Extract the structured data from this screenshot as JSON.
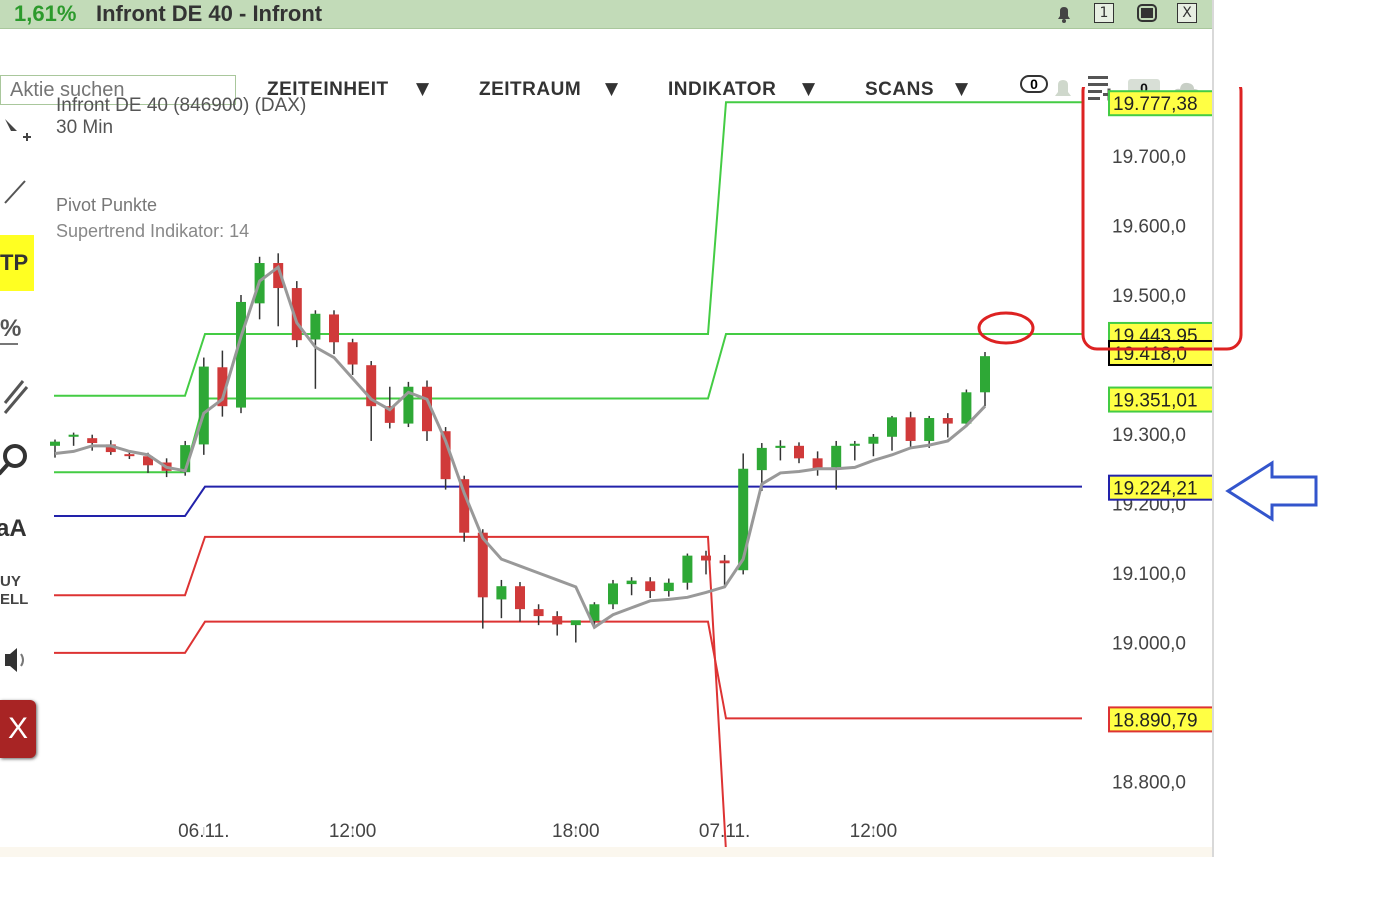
{
  "titlebar": {
    "change_pct": "1,61%",
    "name": "Infront DE 40 - Infront",
    "buttons": [
      "1",
      "X"
    ]
  },
  "toolbar": {
    "search_placeholder": "Aktie suchen",
    "menus": [
      "ZEITEINHEIT",
      "ZEITRAUM",
      "INDIKATOR",
      "SCANS"
    ],
    "caret": "▼",
    "alerts_count": "0",
    "list_count": "0"
  },
  "chart": {
    "instrument": "Infront DE 40 (846900) (DAX)",
    "interval": "30 Min",
    "indicator_1": "Pivot Punkte",
    "indicator_2": "Supertrend Indikator: 14"
  },
  "left_tools": {
    "tp": "TP",
    "percent": "%",
    "text_tool": "aA",
    "buy": "UY",
    "sell": "ELL",
    "close": "X"
  },
  "colors": {
    "up_candle": "#2ea836",
    "down_candle": "#d03a3a",
    "resistance": "#44cc44",
    "pivot": "#2222aa",
    "support": "#dd3333",
    "supertrend": "#999999",
    "price_label_bg": "#ffff44",
    "annotation_red": "#dd2222",
    "annotation_blue": "#3355cc"
  },
  "chart_data": {
    "type": "candlestick",
    "y_ticks": [
      "19.700,0",
      "19.600,0",
      "19.500,0",
      "19.300,0",
      "19.200,0",
      "19.100,0",
      "19.000,0",
      "18.800,0"
    ],
    "x_ticks": [
      "06.11.",
      "12:00",
      "18:00",
      "07.11.",
      "12:00"
    ],
    "price_labels": [
      {
        "text": "19.777,38",
        "color": "#44cc44"
      },
      {
        "text": "19.443,95",
        "color": "#44cc44"
      },
      {
        "text": "19.418,0",
        "color": "#000000"
      },
      {
        "text": "19.351,01",
        "color": "#44cc44"
      },
      {
        "text": "19.224,21",
        "color": "#2222aa"
      },
      {
        "text": "18.890,79",
        "color": "#dd3333"
      }
    ],
    "pivot_levels": {
      "R2": [
        19355,
        19777.38
      ],
      "R1": [
        19245,
        19443.95
      ],
      "PP": [
        19182,
        19224.21
      ],
      "S1": [
        19068,
        19057
      ],
      "S2": [
        18985,
        19030,
        18890.79
      ]
    },
    "candles": [
      [
        19283,
        19292,
        19275,
        19266,
        19289
      ],
      [
        19296,
        19302,
        19280,
        19283,
        19299
      ],
      [
        19294,
        19299,
        19274,
        19276,
        19287
      ],
      [
        19285,
        19291,
        19265,
        19270,
        19274
      ],
      [
        19271,
        19275,
        19261,
        19264,
        19269
      ],
      [
        19268,
        19273,
        19246,
        19244,
        19255
      ],
      [
        19259,
        19265,
        19240,
        19238,
        19247
      ],
      [
        19245,
        19290,
        19242,
        19240,
        19284
      ],
      [
        19285,
        19410,
        19275,
        19270,
        19397
      ],
      [
        19396,
        19420,
        19330,
        19325,
        19340
      ],
      [
        19338,
        19500,
        19333,
        19330,
        19490
      ],
      [
        19488,
        19555,
        19470,
        19465,
        19546
      ],
      [
        19546,
        19560,
        19470,
        19455,
        19510
      ],
      [
        19510,
        19520,
        19430,
        19425,
        19435
      ],
      [
        19436,
        19478,
        19425,
        19365,
        19473
      ],
      [
        19472,
        19478,
        19422,
        19415,
        19432
      ],
      [
        19432,
        19437,
        19390,
        19385,
        19400
      ],
      [
        19399,
        19405,
        19330,
        19290,
        19340
      ],
      [
        19340,
        19368,
        19310,
        19308,
        19316
      ],
      [
        19315,
        19375,
        19312,
        19310,
        19368
      ],
      [
        19368,
        19377,
        19296,
        19290,
        19304
      ],
      [
        19304,
        19310,
        19232,
        19220,
        19235
      ],
      [
        19235,
        19240,
        19150,
        19145,
        19158
      ],
      [
        19158,
        19163,
        19055,
        19020,
        19065
      ],
      [
        19062,
        19090,
        19038,
        19035,
        19081
      ],
      [
        19081,
        19087,
        19042,
        19030,
        19048
      ],
      [
        19048,
        19055,
        19030,
        19025,
        19038
      ],
      [
        19038,
        19045,
        19020,
        19010,
        19026
      ],
      [
        19025,
        19030,
        19020,
        19000,
        19032
      ],
      [
        19031,
        19058,
        19024,
        19020,
        19055
      ],
      [
        19055,
        19090,
        19052,
        19048,
        19085
      ],
      [
        19084,
        19094,
        19074,
        19068,
        19089
      ],
      [
        19088,
        19094,
        19068,
        19064,
        19074
      ],
      [
        19074,
        19092,
        19068,
        19066,
        19086
      ],
      [
        19086,
        19128,
        19080,
        19076,
        19125
      ],
      [
        19125,
        19132,
        19112,
        19098,
        19118
      ],
      [
        19118,
        19126,
        19090,
        19082,
        19114
      ],
      [
        19104,
        19272,
        19100,
        19098,
        19250
      ],
      [
        19248,
        19287,
        19240,
        19218,
        19280
      ],
      [
        19280,
        19291,
        19268,
        19262,
        19283
      ],
      [
        19283,
        19288,
        19262,
        19258,
        19265
      ],
      [
        19265,
        19275,
        19244,
        19240,
        19250
      ],
      [
        19252,
        19290,
        19248,
        19220,
        19283
      ],
      [
        19283,
        19290,
        19270,
        19262,
        19286
      ],
      [
        19286,
        19300,
        19272,
        19268,
        19296
      ],
      [
        19296,
        19326,
        19280,
        19276,
        19324
      ],
      [
        19324,
        19332,
        19284,
        19280,
        19290
      ],
      [
        19290,
        19326,
        19282,
        19280,
        19323
      ],
      [
        19323,
        19330,
        19310,
        19295,
        19315
      ],
      [
        19315,
        19364,
        19312,
        19310,
        19360
      ],
      [
        19360,
        19418,
        19355,
        19340,
        19412
      ]
    ],
    "supertrend": [
      19272,
      19275,
      19283,
      19283,
      19275,
      19270,
      19252,
      19247,
      19330,
      19350,
      19440,
      19520,
      19540,
      19460,
      19425,
      19410,
      19380,
      19350,
      19335,
      19360,
      19350,
      19290,
      19215,
      19150,
      19120,
      19110,
      19100,
      19090,
      19080,
      19022,
      19040,
      19050,
      19060,
      19062,
      19065,
      19072,
      19080,
      19120,
      19228,
      19244,
      19246,
      19250,
      19250,
      19252,
      19262,
      19270,
      19280,
      19284,
      19290,
      19312,
      19340
    ]
  }
}
